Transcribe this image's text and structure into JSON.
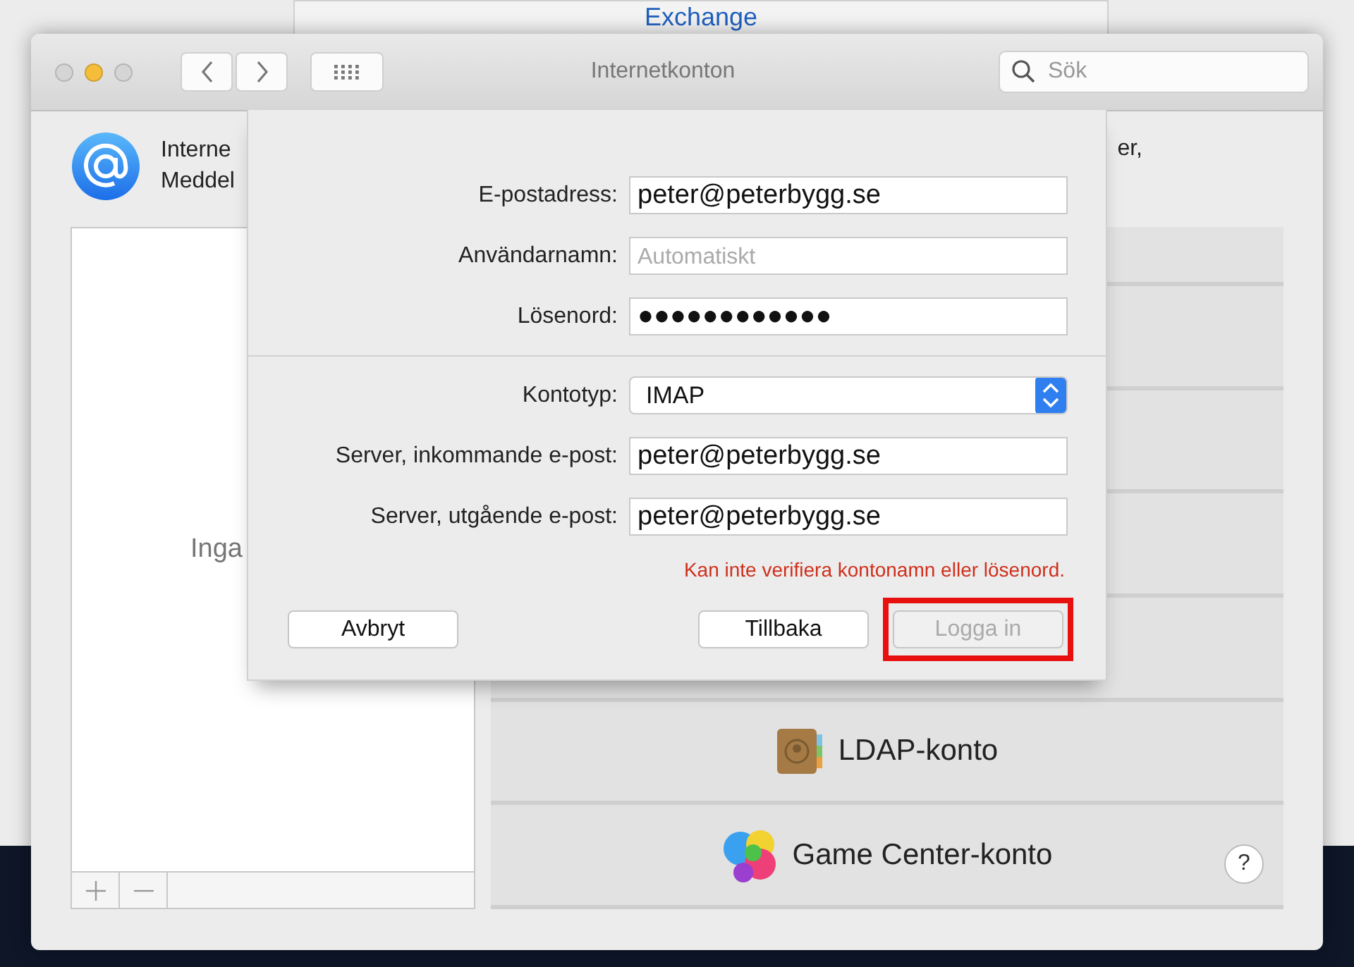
{
  "background_window": {
    "title": "Exchange"
  },
  "window": {
    "title": "Internetkonton",
    "search": {
      "placeholder": "Sök"
    }
  },
  "header": {
    "lines": [
      "Interne",
      "Meddel"
    ],
    "trailing": "er,"
  },
  "account_list": {
    "empty_text": "Inga"
  },
  "help": {
    "label": "?"
  },
  "account_types": [
    {
      "kind": "blank"
    },
    {
      "kind": "blank"
    },
    {
      "kind": "blank"
    },
    {
      "kind": "blank"
    },
    {
      "kind": "blank"
    },
    {
      "label": "LDAP-konto",
      "kind": "ldap"
    },
    {
      "label": "Game Center-konto",
      "kind": "gamecenter"
    }
  ],
  "sheet": {
    "credentials": [
      {
        "label": "E-postadress:",
        "value": "peter@peterbygg.se"
      },
      {
        "label": "Användarnamn:",
        "placeholder": "Automatiskt"
      },
      {
        "label": "Lösenord:",
        "value": "●●●●●●●●●●●●"
      }
    ],
    "account_type": {
      "label": "Kontotyp:",
      "value": "IMAP"
    },
    "servers": [
      {
        "label": "Server, inkommande e-post:",
        "value": "peter@peterbygg.se"
      },
      {
        "label": "Server, utgående e-post:",
        "value": "peter@peterbygg.se"
      }
    ],
    "error": "Kan inte verifiera kontonamn eller lösenord.",
    "cancel": {
      "label": "Avbryt"
    },
    "buttons": [
      {
        "label": "Tillbaka",
        "disabled": false,
        "highlighted": false
      },
      {
        "label": "Logga in",
        "disabled": true,
        "highlighted": true
      }
    ]
  }
}
